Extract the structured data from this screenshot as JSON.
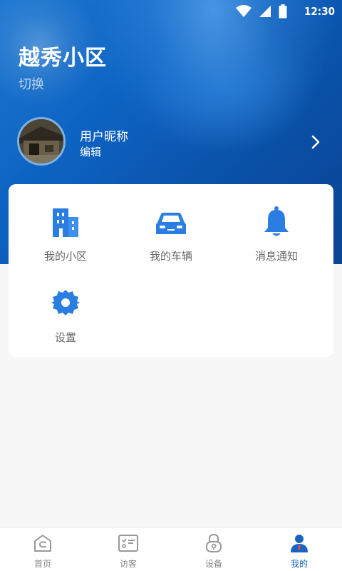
{
  "status_bar": {
    "time": "12:30"
  },
  "header": {
    "community_name": "越秀小区",
    "switch_label": "切换"
  },
  "profile": {
    "nickname": "用户昵称",
    "edit_label": "编辑"
  },
  "menu": {
    "items": [
      {
        "label": "我的小区",
        "icon": "building-icon"
      },
      {
        "label": "我的车辆",
        "icon": "car-icon"
      },
      {
        "label": "消息通知",
        "icon": "bell-icon"
      },
      {
        "label": "设置",
        "icon": "gear-icon"
      }
    ]
  },
  "tabbar": {
    "items": [
      {
        "label": "首页",
        "icon": "home-icon"
      },
      {
        "label": "访客",
        "icon": "visitor-card-icon"
      },
      {
        "label": "设备",
        "icon": "lock-icon"
      },
      {
        "label": "我的",
        "icon": "user-icon"
      }
    ],
    "active_index": 3
  },
  "colors": {
    "accent": "#1565c0",
    "icon_blue": "#2a7de1",
    "header_blue": "#0d63c2",
    "inactive": "#888888"
  }
}
